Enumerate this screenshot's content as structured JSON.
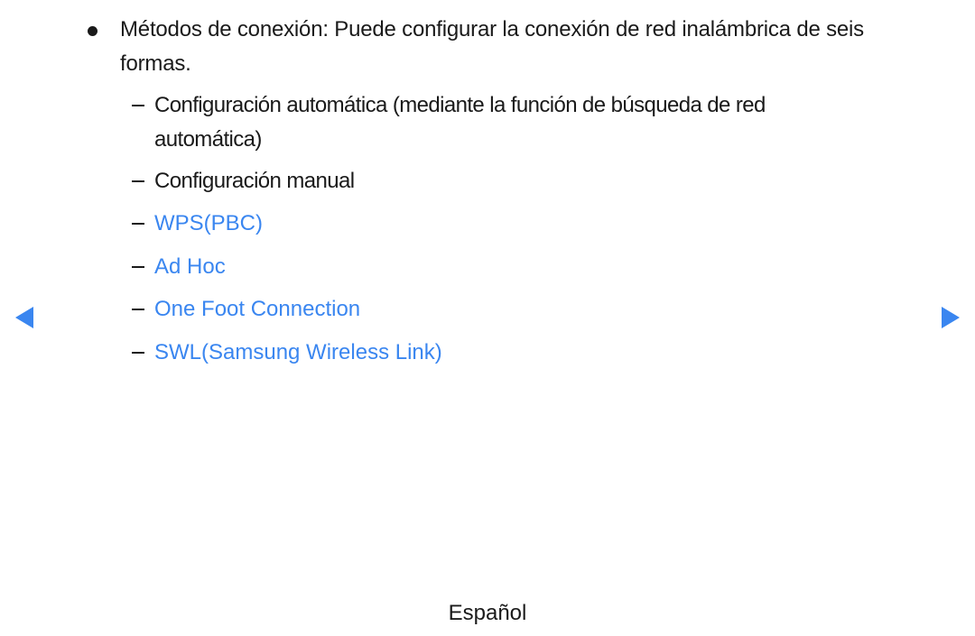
{
  "main": {
    "bullet": {
      "text": "Métodos de conexión: Puede configurar la conexión de red inalámbrica de seis formas."
    },
    "sub_items": [
      {
        "text": "Configuración automática (mediante la función de búsqueda de red automática)",
        "is_link": false
      },
      {
        "text": "Configuración manual",
        "is_link": false
      },
      {
        "text": "WPS(PBC)",
        "is_link": true
      },
      {
        "text": "Ad Hoc",
        "is_link": true
      },
      {
        "text": "One Foot Connection",
        "is_link": true
      },
      {
        "text": "SWL(Samsung Wireless Link)",
        "is_link": true
      }
    ]
  },
  "navigation": {
    "prev_icon": "triangle-left",
    "next_icon": "triangle-right"
  },
  "footer": {
    "language": "Español"
  },
  "colors": {
    "accent": "#3a86f0",
    "text": "#1a1a1a",
    "background": "#ffffff"
  }
}
